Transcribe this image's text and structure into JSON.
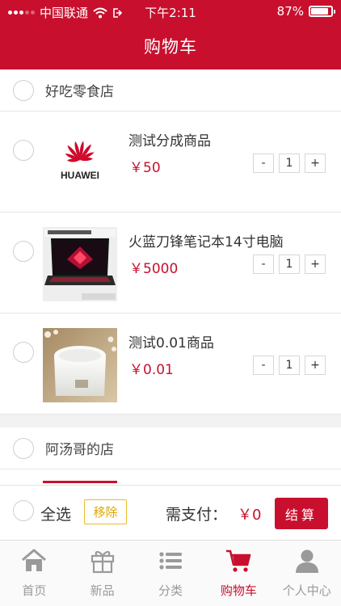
{
  "status_bar": {
    "carrier": "中国联通",
    "time": "下午2:11",
    "battery": "87%",
    "battery_level": 0.87
  },
  "header": {
    "title": "购物车"
  },
  "stores": [
    {
      "name": "好吃零食店",
      "items": [
        {
          "title": "测试分成商品",
          "price": "￥50",
          "qty": "1",
          "image": "huawei-logo",
          "logo_text": "HUAWEI"
        },
        {
          "title": "火蓝刀锋笔记本14寸电脑",
          "price": "￥5000",
          "qty": "1",
          "image": "laptop-photo"
        },
        {
          "title": "测试0.01商品",
          "price": "￥0.01",
          "qty": "1",
          "image": "cream-jar-photo"
        }
      ]
    },
    {
      "name": "阿汤哥的店",
      "items": []
    }
  ],
  "stepper": {
    "minus": "-",
    "plus": "+"
  },
  "action_bar": {
    "select_all": "全选",
    "remove": "移除",
    "pay_label": "需支付：",
    "pay_amount": "￥0",
    "checkout": "结算"
  },
  "tabs": [
    {
      "label": "首页",
      "icon": "home-icon",
      "active": false
    },
    {
      "label": "新品",
      "icon": "gift-icon",
      "active": false
    },
    {
      "label": "分类",
      "icon": "list-icon",
      "active": false
    },
    {
      "label": "购物车",
      "icon": "cart-icon",
      "active": true
    },
    {
      "label": "个人中心",
      "icon": "user-icon",
      "active": false
    }
  ],
  "colors": {
    "brand": "#c8102e",
    "remove_border": "#e9bd2a",
    "tab_inactive": "#9a9a9a"
  }
}
